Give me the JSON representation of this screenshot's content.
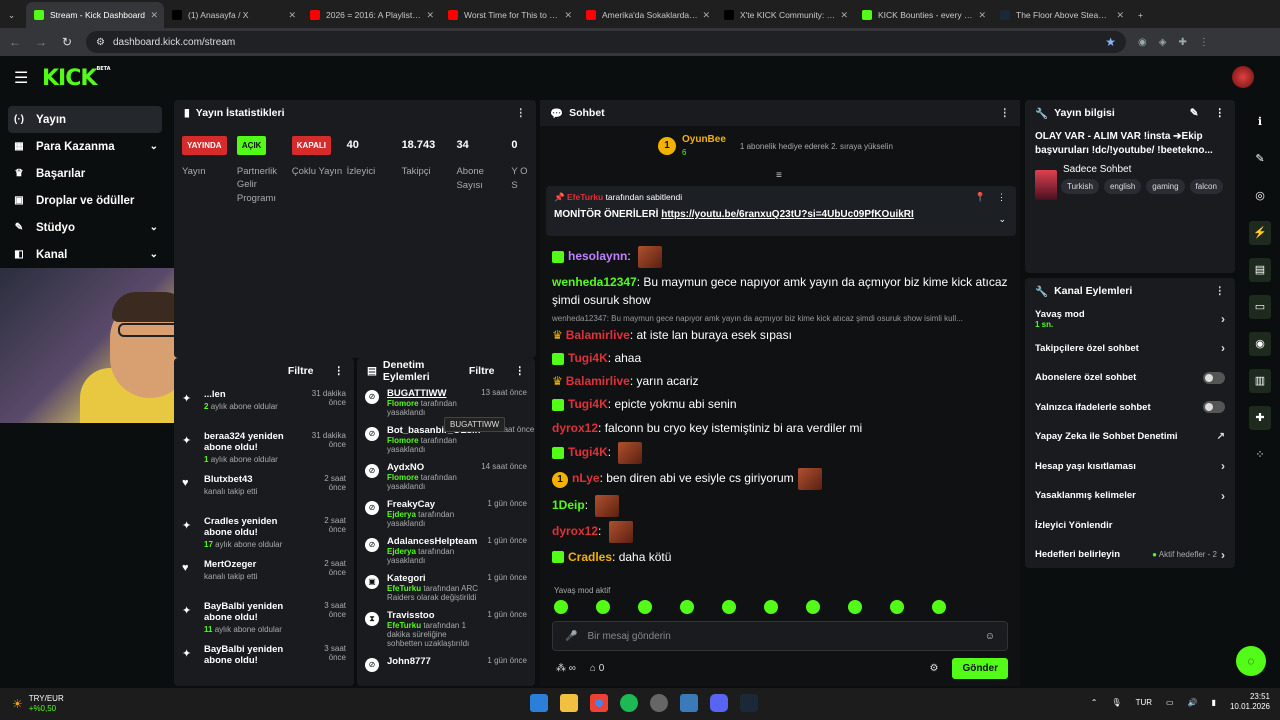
{
  "browser": {
    "tabs": [
      {
        "title": "Stream - Kick Dashboard",
        "color": "#53fc18",
        "active": true
      },
      {
        "title": "(1) Anasayfa / X",
        "color": "#000000"
      },
      {
        "title": "2026 = 2016: A Playlist - Y",
        "color": "#ff0000"
      },
      {
        "title": "Worst Time for This to Ha",
        "color": "#ff0000"
      },
      {
        "title": "Amerika'da Sokaklardan P",
        "color": "#ff0000"
      },
      {
        "title": "X'te KICK Community: \"ne",
        "color": "#000000"
      },
      {
        "title": "KICK Bounties - every pla",
        "color": "#53fc18"
      },
      {
        "title": "The Floor Above Steam's O",
        "color": "#1b2838"
      }
    ],
    "url": "dashboard.kick.com/stream"
  },
  "sidebar": {
    "items": [
      {
        "label": "Yayın",
        "icon": "stream-icon",
        "glyph": "(·)"
      },
      {
        "label": "Para Kazanma",
        "icon": "money-icon",
        "glyph": "▦",
        "chev": "⌄"
      },
      {
        "label": "Başarılar",
        "icon": "trophy-icon",
        "glyph": "♛"
      },
      {
        "label": "Droplar ve ödüller",
        "icon": "gift-icon",
        "glyph": "▣"
      },
      {
        "label": "Stüdyo",
        "icon": "studio-icon",
        "glyph": "✎",
        "chev": "⌄"
      },
      {
        "label": "Kanal",
        "icon": "channel-icon",
        "glyph": "◧",
        "chev": "⌄"
      }
    ]
  },
  "stats": {
    "title": "Yayın İstatistikleri",
    "items": [
      {
        "badge": "YAYINDA",
        "label": "Yayın",
        "type": "red"
      },
      {
        "badge": "AÇIK",
        "label": "Partnerlik Gelir Programı",
        "type": "green"
      },
      {
        "badge": "KAPALI",
        "label": "Çoklu Yayın",
        "type": "red"
      },
      {
        "num": "40",
        "label": "İzleyici"
      },
      {
        "num": "18.743",
        "label": "Takipçi"
      },
      {
        "num": "34",
        "label": "Abone Sayısı"
      },
      {
        "num": "0",
        "label": "Y O S"
      }
    ]
  },
  "events": {
    "filter": "Filtre",
    "items": [
      {
        "icon": "star-icon",
        "glyph": "✦",
        "title": "...len",
        "sub_b": "2",
        "sub": "aylık abone oldular",
        "time": "31 dakika önce"
      },
      {
        "icon": "star-icon",
        "glyph": "✦",
        "title": "beraa324 yeniden abone oldu!",
        "sub_b": "1",
        "sub": "aylık abone oldular",
        "time": "31 dakika önce"
      },
      {
        "icon": "heart-icon",
        "glyph": "♥",
        "title": "Blutxbet43",
        "sub_b": "",
        "sub": "kanalı takip etti",
        "time": "2 saat önce"
      },
      {
        "icon": "star-icon",
        "glyph": "✦",
        "title": "Cradles yeniden abone oldu!",
        "sub_b": "17",
        "sub": "aylık abone oldular",
        "time": "2 saat önce"
      },
      {
        "icon": "heart-icon",
        "glyph": "♥",
        "title": "MertOzeger",
        "sub_b": "",
        "sub": "kanalı takip etti",
        "time": "2 saat önce"
      },
      {
        "icon": "star-icon",
        "glyph": "✦",
        "title": "BayBalbi yeniden abone oldu!",
        "sub_b": "11",
        "sub": "aylık abone oldular",
        "time": "3 saat önce"
      },
      {
        "icon": "star-icon",
        "glyph": "✦",
        "title": "BayBalbi yeniden abone oldu!",
        "sub_b": "",
        "sub": "",
        "time": "3 saat önce"
      }
    ]
  },
  "modlog": {
    "title": "Denetim Eylemleri",
    "filter": "Filtre",
    "tooltip": "BUGATTIWW",
    "items": [
      {
        "title": "BUGATTIWW",
        "sub_b": "Flomore",
        "sub": "tarafından yasaklandı",
        "time": "13 saat önce"
      },
      {
        "title": "Bot_basanbir_OEsin",
        "sub_b": "Flomore",
        "sub": "tarafından yasaklandı",
        "time": "14 saat önce"
      },
      {
        "title": "AydxNO",
        "sub_b": "Flomore",
        "sub": "tarafından yasaklandı",
        "time": "14 saat önce"
      },
      {
        "title": "FreakyCay",
        "sub_b": "Ejderya",
        "sub": "tarafından yasaklandı",
        "time": "1 gün önce"
      },
      {
        "title": "AdalancesHelpteam",
        "sub_b": "Ejderya",
        "sub": "tarafından yasaklandı",
        "time": "1 gün önce"
      },
      {
        "title": "Kategori",
        "sub_b": "EfeTurku",
        "sub": "tarafından ARC Raiders olarak değiştirildi",
        "time": "1 gün önce"
      },
      {
        "title": "Travisstoo",
        "sub_b": "EfeTurku",
        "sub": "tarafından 1 dakika süreliğine sohbetten uzaklaştırıldı",
        "time": "1 gün önce"
      },
      {
        "title": "John8777",
        "sub_b": "",
        "sub": "",
        "time": "1 gün önce"
      }
    ]
  },
  "chat": {
    "title": "Sohbet",
    "top_user": "OyunBee",
    "top_rank": "1",
    "top_count": "6",
    "gift_note": "1 abonelik hediye ederek 2. sıraya yükselin",
    "pinned_by": "EfeTurku",
    "pinned_label": "tarafından sabitlendi",
    "pinned_text": "MONİTÖR ÖNERİLERİ",
    "pinned_link": "https://youtu.be/6ranxuQ23tU?si=4UbUc09PfKOuikRI",
    "messages": [
      {
        "user": "hesolaynn",
        "color": "#c080ff",
        "text": "",
        "emote": true,
        "gift": true
      },
      {
        "user": "wenheda12347",
        "color": "#53fc18",
        "text": "Bu maymun gece napıyor amk yayın da açmıyor biz kime kick atıcaz şimdi osuruk show"
      },
      {
        "reply": "wenheda12347: Bu maymun gece napıyor amk yayın da açmıyor biz kime kick atıcaz şimdi osuruk show isimli kull...",
        "user": "Balamirlive",
        "color": "#e0303a",
        "text": "at iste lan buraya esek sıpası",
        "crown": true
      },
      {
        "user": "Tugi4K",
        "color": "#e0303a",
        "text": "ahaa",
        "gift": true
      },
      {
        "user": "Balamirlive",
        "color": "#e0303a",
        "text": "yarın acariz",
        "crown": true
      },
      {
        "user": "Tugi4K",
        "color": "#e0303a",
        "text": "epicte yokmu abi senin",
        "gift": true
      },
      {
        "user": "dyrox12",
        "color": "#e0303a",
        "text": "falconn bu cryo key istemiştiniz bi ara verdiler mi"
      },
      {
        "user": "Tugi4K",
        "color": "#e0303a",
        "text": "",
        "emote": true,
        "gift": true
      },
      {
        "user": "nLye",
        "color": "#e0303a",
        "text": "ben diren abi ve esiyle cs giriyorum",
        "emote_after": true,
        "coin": true
      },
      {
        "user": "1Deip",
        "color": "#53fc18",
        "text": "",
        "emote": true
      },
      {
        "user": "dyrox12",
        "color": "#e0303a",
        "text": "",
        "emote": true
      },
      {
        "user": "Cradles",
        "color": "#f2b200",
        "text": "daha kötü",
        "gift": true
      }
    ],
    "slow_mode": "Yavaş mod aktif",
    "placeholder": "Bir mesaj gönderin",
    "points": "∞",
    "store_count": "0",
    "send": "Gönder"
  },
  "info": {
    "title_label": "Yayın bilgisi",
    "stream_title": "OLAY VAR - ALIM VAR !insta ➔Ekip başvuruları !dc/!youtube/ !beeteknо...",
    "category": "Sadece Sohbet",
    "tags": [
      "Turkish",
      "english",
      "gaming",
      "falcon"
    ]
  },
  "actions": {
    "title": "Kanal Eylemleri",
    "items": [
      {
        "label": "Yavaş mod",
        "sub": "1 sn.",
        "control": "chevron"
      },
      {
        "label": "Takipçilere özel sohbet",
        "control": "chevron"
      },
      {
        "label": "Abonelere özel sohbet",
        "control": "toggle"
      },
      {
        "label": "Yalnızca ifadelerle sohbet",
        "control": "toggle"
      },
      {
        "label": "Yapay Zeka ile Sohbet Denetimi",
        "control": "external"
      },
      {
        "label": "Hesap yaşı kısıtlaması",
        "control": "chevron"
      },
      {
        "label": "Yasaklanmış kelimeler",
        "control": "chevron"
      },
      {
        "label": "İzleyici Yönlendir",
        "control": "none"
      },
      {
        "label": "Hedefleri belirleyin",
        "sub_inline": "Aktif hedefler - 2",
        "control": "chevron"
      }
    ]
  },
  "taskbar": {
    "ticker": "TRY/EUR",
    "ticker_change": "+%0,50",
    "lang": "TUR",
    "time": "23:51",
    "date": "10.01.2026"
  },
  "colors": {
    "accent": "#53fc18",
    "bg": "#0b0e0f",
    "panel": "#191b1f"
  }
}
